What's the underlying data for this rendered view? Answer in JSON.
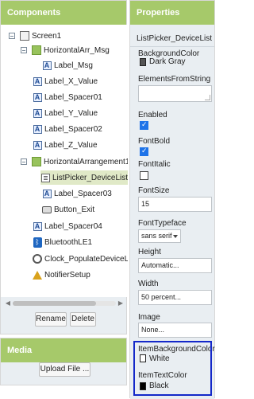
{
  "components": {
    "title": "Components",
    "tree": [
      {
        "label": "Screen1",
        "icon": "screen-icon"
      },
      {
        "label": "HorizontalArr_Msg",
        "icon": "horizontal-arrangement-icon"
      },
      {
        "label": "Label_Msg",
        "icon": "label-icon"
      },
      {
        "label": "Label_X_Value",
        "icon": "label-icon"
      },
      {
        "label": "Label_Spacer01",
        "icon": "label-icon"
      },
      {
        "label": "Label_Y_Value",
        "icon": "label-icon"
      },
      {
        "label": "Label_Spacer02",
        "icon": "label-icon"
      },
      {
        "label": "Label_Z_Value",
        "icon": "label-icon"
      },
      {
        "label": "HorizontalArrangement1",
        "icon": "horizontal-arrangement-icon"
      },
      {
        "label": "ListPicker_DeviceList",
        "icon": "list-picker-icon",
        "selected": true
      },
      {
        "label": "Label_Spacer03",
        "icon": "label-icon"
      },
      {
        "label": "Button_Exit",
        "icon": "button-icon"
      },
      {
        "label": "Label_Spacer04",
        "icon": "label-icon"
      },
      {
        "label": "BluetoothLE1",
        "icon": "bluetooth-icon"
      },
      {
        "label": "Clock_PopulateDeviceList",
        "icon": "clock-icon"
      },
      {
        "label": "NotifierSetup",
        "icon": "notifier-icon"
      }
    ],
    "rename_label": "Rename",
    "delete_label": "Delete"
  },
  "media": {
    "title": "Media",
    "upload_label": "Upload File ..."
  },
  "properties": {
    "title": "Properties",
    "component_name": "ListPicker_DeviceList",
    "background_color": {
      "label": "BackgroundColor",
      "value": "Dark Gray",
      "swatch": "#555555"
    },
    "elements_from_string": {
      "label": "ElementsFromString",
      "value": ""
    },
    "enabled": {
      "label": "Enabled",
      "checked": true
    },
    "font_bold": {
      "label": "FontBold",
      "checked": true
    },
    "font_italic": {
      "label": "FontItalic",
      "checked": false
    },
    "font_size": {
      "label": "FontSize",
      "value": "15"
    },
    "font_typeface": {
      "label": "FontTypeface",
      "value": "sans serif"
    },
    "height": {
      "label": "Height",
      "value": "Automatic..."
    },
    "width": {
      "label": "Width",
      "value": "50 percent..."
    },
    "image": {
      "label": "Image",
      "value": "None..."
    },
    "item_background_color": {
      "label": "ItemBackgroundColor",
      "value": "White",
      "swatch": "#ffffff"
    },
    "item_text_color": {
      "label": "ItemTextColor",
      "value": "Black",
      "swatch": "#000000"
    }
  },
  "colors": {
    "header_green": "#a6c96a",
    "selected_bg": "#e0e9c7",
    "highlight_border": "#1428c9",
    "checkbox_blue": "#1e73e8"
  }
}
